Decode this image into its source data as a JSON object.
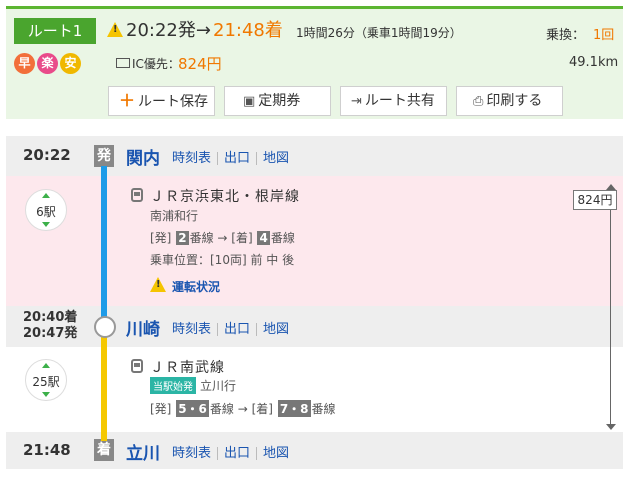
{
  "route": {
    "label": "ルート1",
    "badges": [
      {
        "char": "早",
        "color": "#f26f3a"
      },
      {
        "char": "楽",
        "color": "#e94b8a"
      },
      {
        "char": "安",
        "color": "#f0b800"
      }
    ],
    "depart_time": "20:22発→",
    "arrive_time": "21:48着",
    "duration": "1時間26分（乗車1時間19分）",
    "transfer_label": "乗換：",
    "transfer_count": "1回",
    "ic_label": "IC優先：",
    "fare": "824円",
    "distance": "49.1km"
  },
  "actions": {
    "save": "ルート保存",
    "commuter": "定期券",
    "share": "ルート共有",
    "print": "印刷する"
  },
  "stations": [
    {
      "time": "20:22",
      "marker": "発",
      "name": "関内"
    },
    {
      "time_arr": "20:40着",
      "time_dep": "20:47発",
      "name": "川崎"
    },
    {
      "time": "21:48",
      "marker": "着",
      "name": "立川"
    }
  ],
  "station_links": {
    "timetable": "時刻表",
    "exit": "出口",
    "map": "地図"
  },
  "legs": [
    {
      "stops": "6駅",
      "line": "ＪＲ京浜東北・根岸線",
      "direction": "南浦和行",
      "dep_label": "[発]",
      "dep_platform": "2",
      "arr_label": "→ [着]",
      "arr_platform": "4",
      "platform_suffix": "番線",
      "car_position": "乗車位置：[10両] 前 中 後",
      "status": "運転状況",
      "line_color": "#1e9be8"
    },
    {
      "stops": "25駅",
      "line": "ＪＲ南武線",
      "origin_badge": "当駅始発",
      "direction": "立川行",
      "dep_label": "[発]",
      "dep_platform": "5・6",
      "arr_label": "→ [着]",
      "arr_platform": "7・8",
      "platform_suffix": "番線",
      "line_color": "#f5c800"
    }
  ],
  "fare_total": "824円",
  "icons": [
    "warning-icon",
    "ic-card-icon",
    "plus-icon",
    "commuter-pass-icon",
    "share-icon",
    "printer-icon",
    "train-icon"
  ]
}
